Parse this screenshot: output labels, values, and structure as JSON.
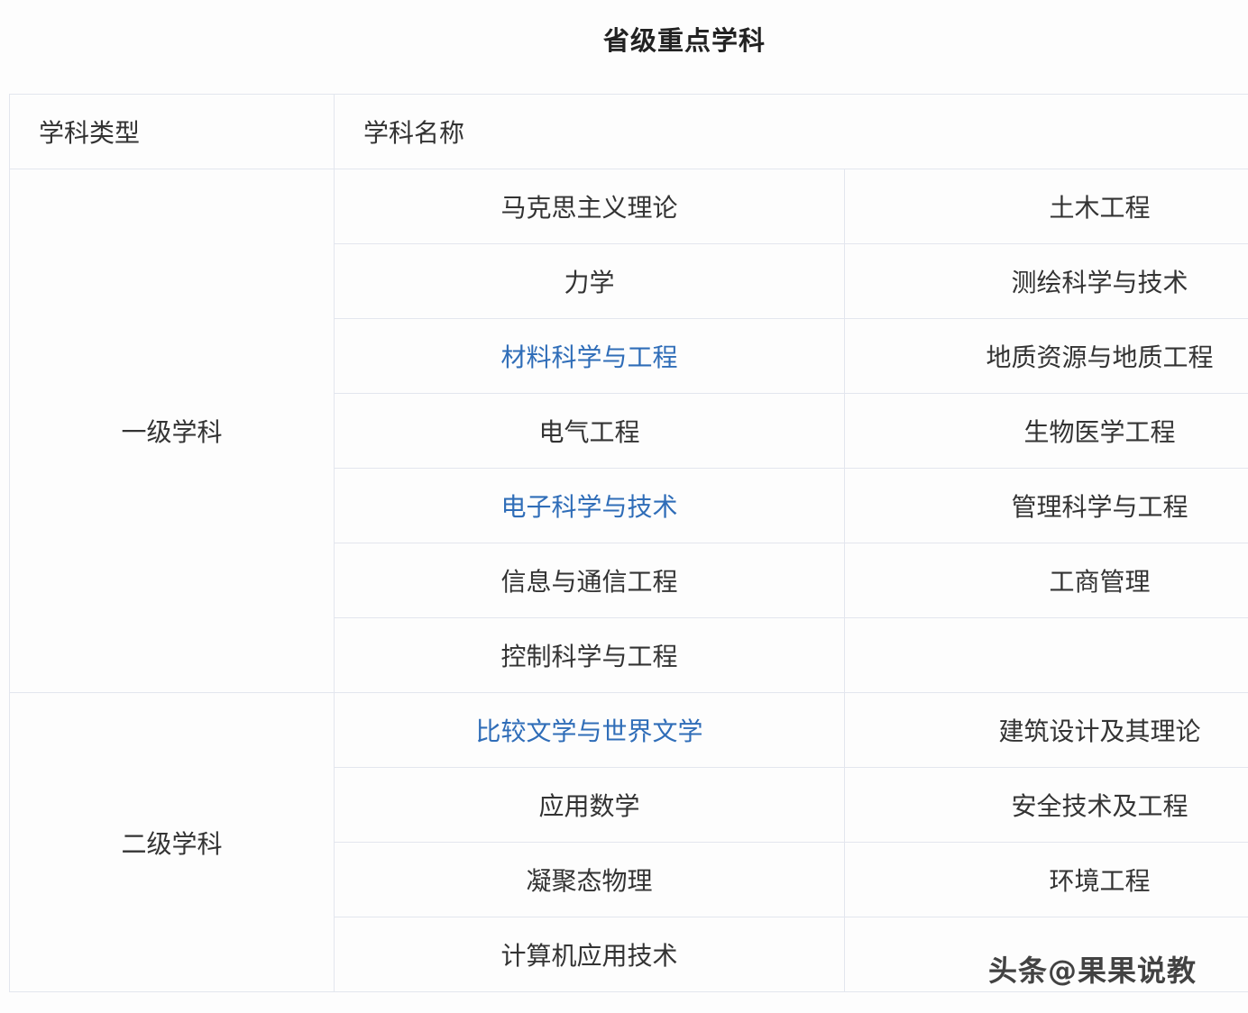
{
  "title": "省级重点学科",
  "header": {
    "type_label": "学科类型",
    "name_label": "学科名称"
  },
  "groups": [
    {
      "type": "一级学科",
      "rows": [
        {
          "left": "马克思主义理论",
          "right": "土木工程"
        },
        {
          "left": "力学",
          "right": "测绘科学与技术"
        },
        {
          "left": "材料科学与工程",
          "right": "地质资源与地质工程"
        },
        {
          "left": "电气工程",
          "right": "生物医学工程"
        },
        {
          "left": "电子科学与技术",
          "right": "管理科学与工程"
        },
        {
          "left": "信息与通信工程",
          "right": "工商管理"
        },
        {
          "left": "控制科学与工程",
          "right": ""
        }
      ]
    },
    {
      "type": "二级学科",
      "rows": [
        {
          "left": "比较文学与世界文学",
          "right": "建筑设计及其理论"
        },
        {
          "left": "应用数学",
          "right": "安全技术及工程"
        },
        {
          "left": "凝聚态物理",
          "right": "环境工程"
        },
        {
          "left": "计算机应用技术",
          "right": ""
        }
      ]
    }
  ],
  "link_color": "#2f6db8",
  "watermark": "头条@果果说教"
}
